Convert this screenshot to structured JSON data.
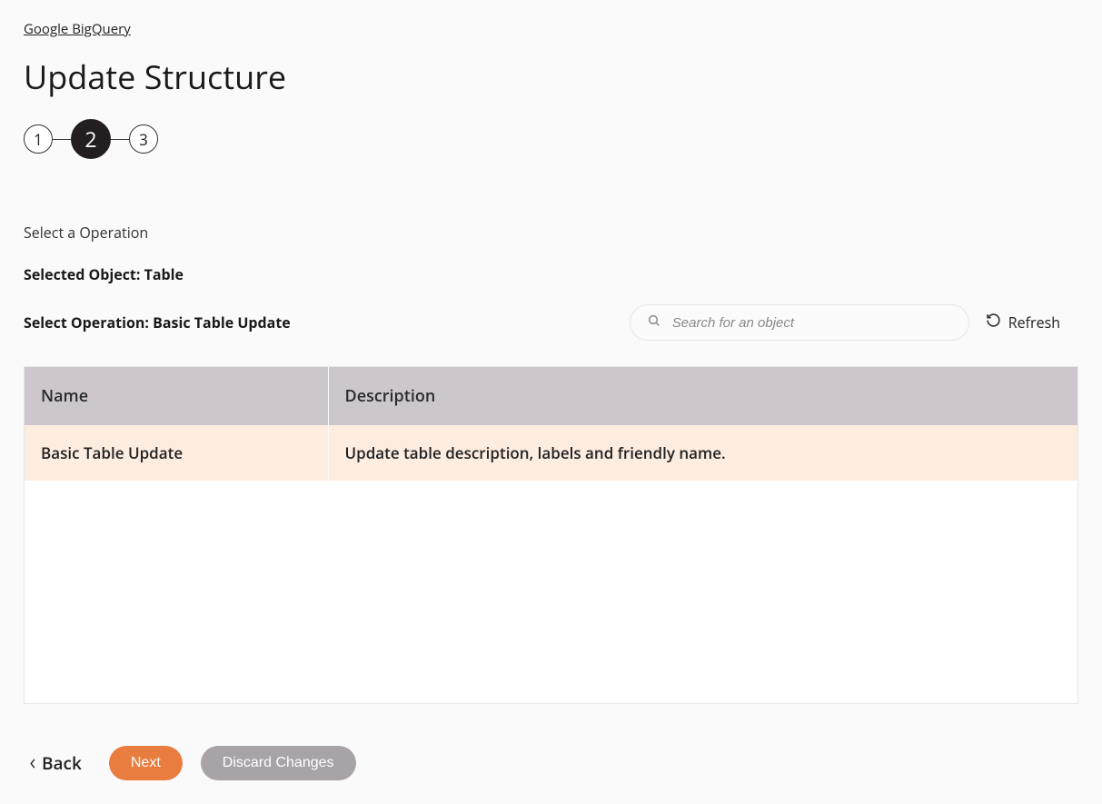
{
  "breadcrumb": {
    "label": "Google BigQuery"
  },
  "page": {
    "title": "Update Structure"
  },
  "steps": {
    "s1": "1",
    "s2": "2",
    "s3": "3"
  },
  "labels": {
    "select_operation_heading": "Select a Operation",
    "selected_object": "Selected Object: Table",
    "select_operation": "Select Operation: Basic Table Update"
  },
  "search": {
    "placeholder": "Search for an object"
  },
  "refresh": {
    "label": "Refresh"
  },
  "table": {
    "headers": {
      "name": "Name",
      "description": "Description"
    },
    "rows": [
      {
        "name": "Basic Table Update",
        "description": "Update table description, labels and friendly name."
      }
    ]
  },
  "footer": {
    "back": "Back",
    "next": "Next",
    "discard": "Discard Changes"
  }
}
